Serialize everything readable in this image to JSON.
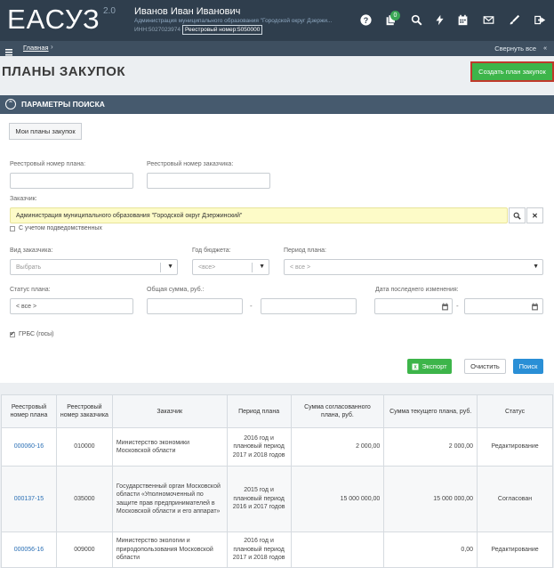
{
  "app": {
    "logo": "ЕАСУЗ",
    "version": "2.0"
  },
  "user": {
    "name": "Иванов Иван Иванович",
    "org": "Администрация муниципального образования \"Городской округ Дзержи...",
    "inn": "ИНН:5027023974",
    "reg_number": "Реестровый номер:5050000"
  },
  "topbar": {
    "icons": [
      "help-icon",
      "documents-icon",
      "search-icon",
      "lightning-icon",
      "calendar-icon",
      "mail-icon",
      "brush-icon",
      "logout-icon"
    ],
    "notification_count": "0"
  },
  "breadcrumb": {
    "home": "Главная",
    "separator": "›",
    "collapse_all": "Свернуть все"
  },
  "page": {
    "title": "ПЛАНЫ ЗАКУПОК",
    "create_button": "Создать план закупок"
  },
  "search": {
    "panel_title": "ПАРАМЕТРЫ ПОИСКА",
    "my_plans_button": "Мои планы закупок",
    "plan_reg_label": "Реестровый номер плана:",
    "plan_reg_value": "",
    "customer_reg_label": "Реестровый номер заказчика:",
    "customer_reg_value": "",
    "customer_label": "Заказчик:",
    "customer_value": "Администрация муниципального образования \"Городской округ Дзержинский\"",
    "subordinate_label": "С учетом подведомственных",
    "customer_type_label": "Вид заказчика:",
    "customer_type_value": "Выбрать",
    "budget_year_label": "Год бюджета:",
    "budget_year_value": "<все>",
    "plan_period_label": "Период плана:",
    "plan_period_value": "< все >",
    "plan_status_label": "Статус плана:",
    "plan_status_value": "< все >",
    "total_sum_label": "Общая сумма, руб.:",
    "sum_from": "",
    "sum_to": "",
    "last_change_label": "Дата последнего изменения:",
    "date_from": "",
    "date_to": "",
    "dash": "-",
    "grbs_label": "ГРБС (госы)",
    "export_button": "Экспорт",
    "clear_button": "Очистить",
    "search_button": "Поиск"
  },
  "table": {
    "headers": [
      "Реестровый номер плана",
      "Реестровый номер заказчика",
      "Заказчик",
      "Период плана",
      "Сумма согласованного плана, руб.",
      "Сумма текущего плана, руб.",
      "Статус"
    ],
    "rows": [
      [
        "000060-16",
        "010000",
        "Министерство экономики Московской области",
        "2016 год и плановый период 2017 и 2018 годов",
        "2 000,00",
        "2 000,00",
        "Редактирование"
      ],
      [
        "000137-15",
        "035000",
        "Государственный орган Московской области «Уполномоченный по защите прав предпринимателей в Московской области и его аппарат»",
        "2015 год и плановый период 2016 и 2017 годов",
        "15 000 000,00",
        "15 000 000,00",
        "Согласован"
      ],
      [
        "000056-16",
        "009000",
        "Министерство экологии и природопользования Московской области",
        "2016 год и плановый период 2017 и 2018 годов",
        "",
        "0,00",
        "Редактирование"
      ]
    ]
  },
  "colors": {
    "topbar": "#2f3e4d",
    "accent_green": "#3db54a",
    "accent_blue": "#2a8fd6",
    "highlight_yellow": "#fdfbc8"
  }
}
